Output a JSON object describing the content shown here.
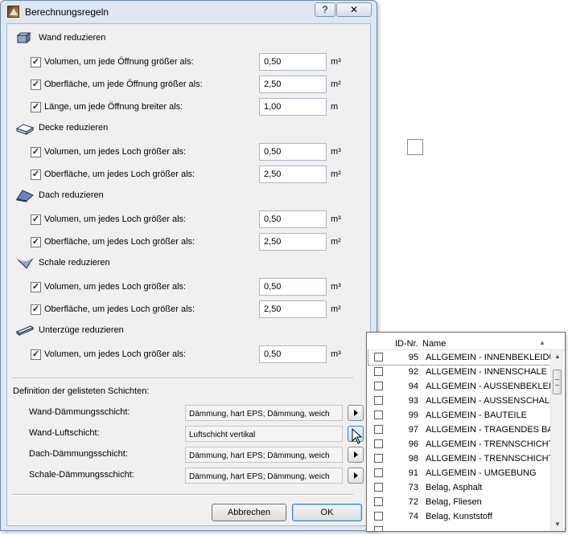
{
  "dialog": {
    "title": "Berechnungsregeln",
    "help_label": "?",
    "close_label": "✕",
    "sections": [
      {
        "title": "Wand reduzieren",
        "icon": "wall-icon",
        "rows": [
          {
            "label": "Volumen, um jede Öffnung größer als:",
            "value": "0,50",
            "unit": "m³",
            "checked": "✓"
          },
          {
            "label": "Oberfläche, um jede Öffnung größer als:",
            "value": "2,50",
            "unit": "m²",
            "checked": "✓"
          },
          {
            "label": "Länge, um jede Öffnung breiter als:",
            "value": "1,00",
            "unit": "m",
            "checked": "✓"
          }
        ]
      },
      {
        "title": "Decke reduzieren",
        "icon": "slab-icon",
        "rows": [
          {
            "label": "Volumen, um jedes Loch größer als:",
            "value": "0,50",
            "unit": "m³",
            "checked": "✓"
          },
          {
            "label": "Oberfläche, um jedes Loch größer als:",
            "value": "2,50",
            "unit": "m²",
            "checked": "✓"
          }
        ]
      },
      {
        "title": "Dach reduzieren",
        "icon": "roof-icon",
        "rows": [
          {
            "label": "Volumen, um jedes Loch größer als:",
            "value": "0,50",
            "unit": "m³",
            "checked": "✓"
          },
          {
            "label": "Oberfläche, um jedes Loch größer als:",
            "value": "2,50",
            "unit": "m²",
            "checked": "✓"
          }
        ]
      },
      {
        "title": "Schale reduzieren",
        "icon": "shell-icon",
        "rows": [
          {
            "label": "Volumen, um jedes Loch größer als:",
            "value": "0,50",
            "unit": "m³",
            "checked": "✓"
          },
          {
            "label": "Oberfläche, um jedes Loch größer als:",
            "value": "2,50",
            "unit": "m²",
            "checked": "✓"
          }
        ]
      },
      {
        "title": "Unterzüge reduzieren",
        "icon": "beam-icon",
        "rows": [
          {
            "label": "Volumen, um jedes Loch größer als:",
            "value": "0,50",
            "unit": "m³",
            "checked": "✓"
          }
        ]
      }
    ],
    "layer_definition_label": "Definition der gelisteten Schichten:",
    "layers": [
      {
        "label": "Wand-Dämmungsschicht:",
        "value": "Dämmung, hart EPS; Dämmung, weich"
      },
      {
        "label": "Wand-Luftschicht:",
        "value": "Luftschicht vertikal"
      },
      {
        "label": "Dach-Dämmungsschicht:",
        "value": "Dämmung, hart EPS; Dämmung, weich"
      },
      {
        "label": "Schale-Dämmungsschicht:",
        "value": "Dämmung, hart EPS; Dämmung, weich"
      }
    ],
    "cancel_label": "Abbrechen",
    "ok_label": "OK"
  },
  "popup_list": {
    "header_id": "ID-Nr.",
    "header_name": "Name",
    "sort_icon": "▲",
    "items": [
      {
        "id": "95",
        "name": "ALLGEMEIN - INNENBEKLEIDUNG"
      },
      {
        "id": "92",
        "name": "ALLGEMEIN - INNENSCHALE"
      },
      {
        "id": "94",
        "name": "ALLGEMEIN - AUSSENBEKLEIDUNG"
      },
      {
        "id": "93",
        "name": "ALLGEMEIN - AUSSENSCHALE"
      },
      {
        "id": "99",
        "name": "ALLGEMEIN - BAUTEILE"
      },
      {
        "id": "97",
        "name": "ALLGEMEIN - TRAGENDES BAUTEIL"
      },
      {
        "id": "96",
        "name": "ALLGEMEIN - TRENNSCHICHT"
      },
      {
        "id": "98",
        "name": "ALLGEMEIN - TRENNSCHICHT AUSSEN"
      },
      {
        "id": "91",
        "name": "ALLGEMEIN - UMGEBUNG"
      },
      {
        "id": "73",
        "name": "Belag, Asphalt"
      },
      {
        "id": "72",
        "name": "Belag, Fliesen"
      },
      {
        "id": "74",
        "name": "Belag, Kunststoff"
      },
      {
        "id": "",
        "name": ""
      }
    ],
    "scroll_up": "▲",
    "scroll_down": "▼"
  },
  "colors": {
    "frame": "#dde6f1",
    "client": "#f0f0f0",
    "accent": "#3c7fb1"
  }
}
